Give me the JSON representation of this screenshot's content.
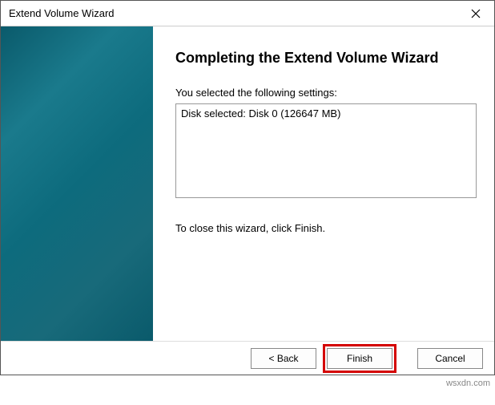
{
  "titlebar": {
    "title": "Extend Volume Wizard"
  },
  "content": {
    "heading": "Completing the Extend Volume Wizard",
    "settings_label": "You selected the following settings:",
    "settings_value": "Disk selected: Disk 0 (126647 MB)",
    "close_instruction": "To close this wizard, click Finish."
  },
  "footer": {
    "back_label": "< Back",
    "finish_label": "Finish",
    "cancel_label": "Cancel"
  },
  "watermark": "wsxdn.com"
}
